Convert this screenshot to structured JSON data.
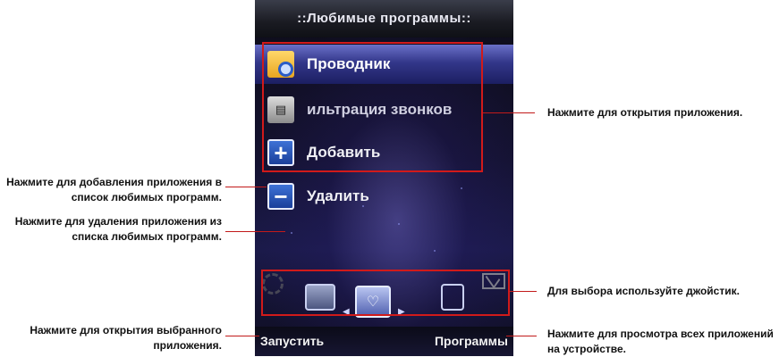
{
  "screen": {
    "title": "::Любимые программы::",
    "items": [
      {
        "label": "Проводник",
        "icon": "folder-search-icon",
        "selected": true
      },
      {
        "label": "ильтрация звонков",
        "icon": "call-filter-icon",
        "selected": false
      },
      {
        "label": "Добавить",
        "icon": "plus-icon",
        "selected": false
      },
      {
        "label": "Удалить",
        "icon": "minus-icon",
        "selected": false
      }
    ],
    "dock_icons": [
      "settings-icon",
      "calendar-clock-icon",
      "calendar-heart-icon",
      "notes-icon",
      "mail-icon"
    ],
    "softkeys": {
      "left": "Запустить",
      "right": "Программы"
    }
  },
  "callouts": {
    "open_app": "Нажмите для открытия приложения.",
    "add_app_line1": "Нажмите для добавления приложения в",
    "add_app_line2": "список любимых программ.",
    "remove_app_line1": "Нажмите для удаления приложения из",
    "remove_app_line2": "списка любимых программ.",
    "joystick": "Для выбора используйте джойстик.",
    "open_selected_line1": "Нажмите для открытия выбранного",
    "open_selected_line2": "приложения.",
    "view_all_line1": "Нажмите для просмотра всех приложений",
    "view_all_line2": "на устройстве."
  },
  "colors": {
    "highlight": "#d11a1a",
    "selected_row": "#33378a"
  }
}
